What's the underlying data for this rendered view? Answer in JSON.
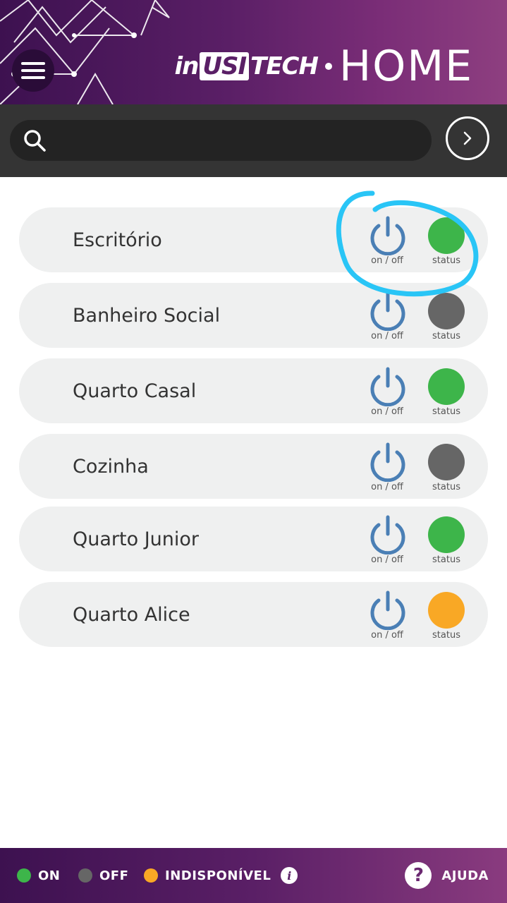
{
  "header": {
    "menu_icon": "hamburger-menu-icon",
    "logo": {
      "brand_prefix": "in",
      "brand_highlight": "USI",
      "brand_suffix": "TECH",
      "product": "HOME"
    }
  },
  "search": {
    "value": "",
    "placeholder": "",
    "search_icon": "search-icon",
    "go_icon": "chevron-right-icon"
  },
  "rooms": [
    {
      "name": "Escritório",
      "power_label": "on / off",
      "status_label": "status",
      "status": "on"
    },
    {
      "name": "Banheiro Social",
      "power_label": "on / off",
      "status_label": "status",
      "status": "off"
    },
    {
      "name": "Quarto Casal",
      "power_label": "on / off",
      "status_label": "status",
      "status": "on"
    },
    {
      "name": "Cozinha",
      "power_label": "on / off",
      "status_label": "status",
      "status": "off"
    },
    {
      "name": "Quarto Junior",
      "power_label": "on / off",
      "status_label": "status",
      "status": "on"
    },
    {
      "name": "Quarto Alice",
      "power_label": "on / off",
      "status_label": "status",
      "status": "unavailable"
    }
  ],
  "legend": {
    "on": "ON",
    "off": "OFF",
    "unavailable": "INDISPONÍVEL",
    "info_icon": "info-icon"
  },
  "help": {
    "label": "AJUDA",
    "icon": "question-mark-icon"
  },
  "colors": {
    "on": "#3db54a",
    "off": "#666666",
    "unavailable": "#f9a825",
    "power_icon": "#4a7fb5",
    "brand_dark": "#3d1150",
    "brand_light": "#8e3f80",
    "annotation": "#29c5f6"
  }
}
